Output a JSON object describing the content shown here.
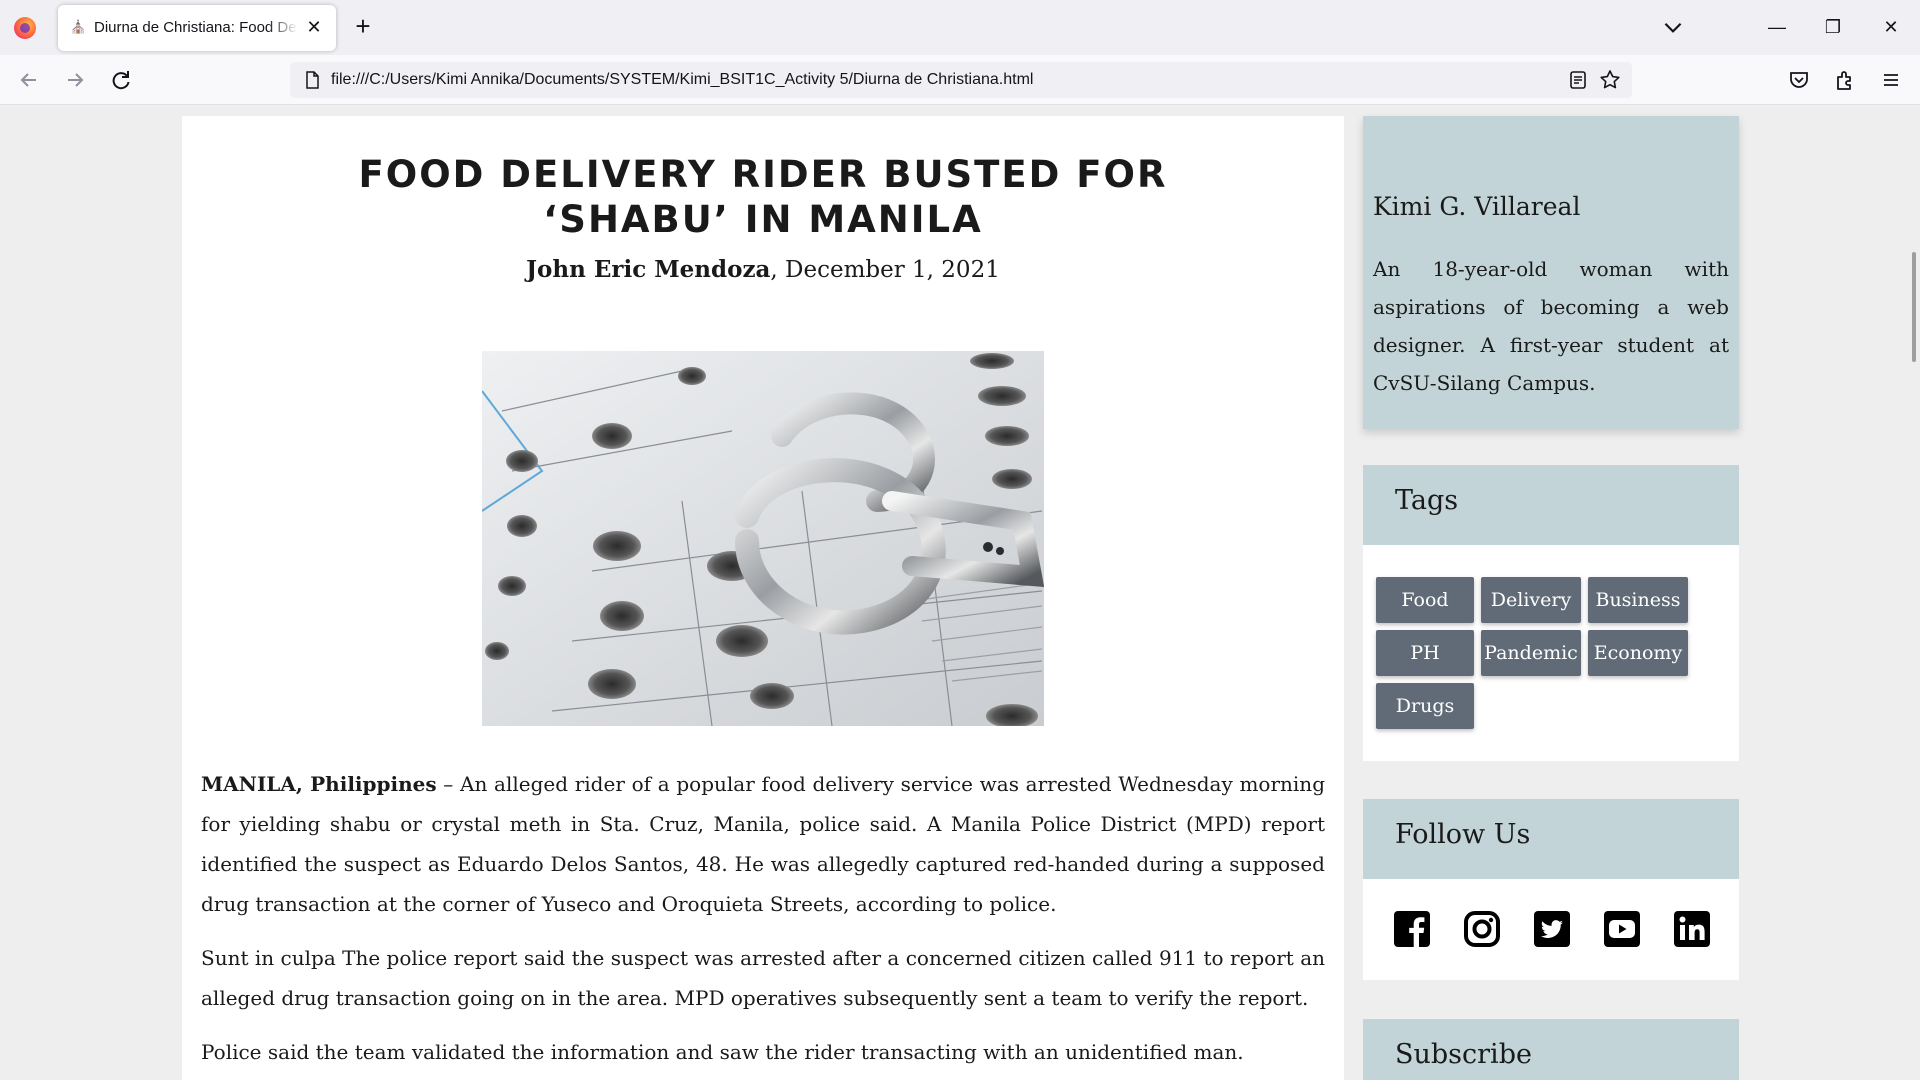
{
  "browser": {
    "tab_title": "Diurna de Christiana: Food Delivery Rider Busted for Shabu in Manila",
    "tab_close": "✕",
    "new_tab": "+",
    "url": "file:///C:/Users/Kimi Annika/Documents/SYSTEM/Kimi_BSIT1C_Activity 5/Diurna de Christiana.html",
    "window_controls": {
      "minimize": "—",
      "restore": "❐",
      "close": "✕"
    },
    "icons": [
      "firefox-logo",
      "back-arrow",
      "forward-arrow",
      "reload",
      "page",
      "reader-view",
      "bookmark-star",
      "pocket",
      "extensions",
      "hamburger-menu",
      "tab-list-chevron"
    ]
  },
  "article": {
    "title_line1": "FOOD DELIVERY RIDER BUSTED FOR",
    "title_line2": "‘SHABU’ IN MANILA",
    "author": "John Eric Mendoza",
    "date_sep": ", ",
    "date": "December 1, 2021",
    "image": "handcuffs-on-fingerprint-cards",
    "paragraphs": [
      {
        "lead": "MANILA, Philippines",
        "text": " – An alleged rider of a popular food delivery service was arrested Wednesday morning for yielding shabu or crystal meth in Sta. Cruz, Manila, police said. A Manila Police District (MPD) report identified the suspect as Eduardo Delos Santos, 48. He was allegedly captured red-handed during a supposed drug transaction at the corner of Yuseco and Oroquieta Streets, according to police."
      },
      {
        "text": "Sunt in culpa The police report said the suspect was arrested after a concerned citizen called 911 to report an alleged drug transaction going on in the area. MPD operatives subsequently sent a team to verify the report."
      },
      {
        "text": "Police said the team validated the information and saw the rider transacting with an unidentified man."
      }
    ]
  },
  "sidebar": {
    "about": {
      "name": "Kimi G. Villareal",
      "bio": "An 18-year-old woman with aspirations of becoming a web designer. A first-year student at CvSU-Silang Campus."
    },
    "tags": {
      "heading": "Tags",
      "items": [
        "Food",
        "Delivery",
        "Business",
        "PH",
        "Pandemic",
        "Economy",
        "Drugs"
      ]
    },
    "follow": {
      "heading": "Follow Us",
      "networks": [
        "facebook",
        "instagram",
        "twitter",
        "youtube",
        "linkedin"
      ]
    },
    "subscribe": {
      "heading": "Subscribe"
    }
  },
  "colors": {
    "sidebar_header_bg": "#c2d4d8",
    "tag_bg": "#616b77",
    "page_bg": "#eeeeee"
  }
}
